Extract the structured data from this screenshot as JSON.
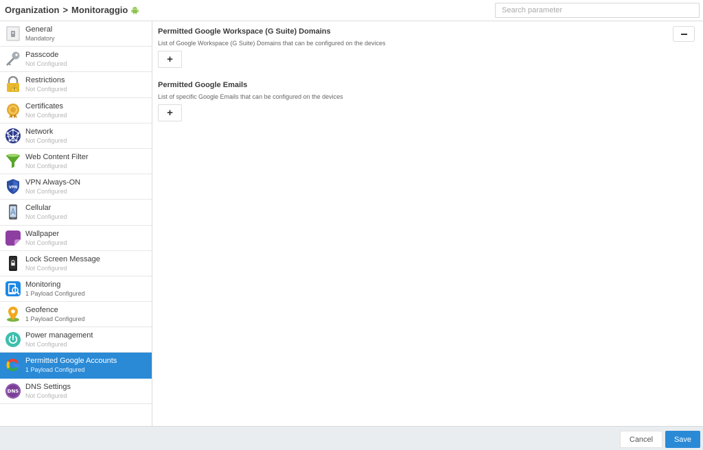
{
  "header": {
    "breadcrumb_root": "Organization",
    "breadcrumb_separator": ">",
    "breadcrumb_current": "Monitoraggio",
    "platform_icon": "android-icon",
    "search_placeholder": "Search parameter"
  },
  "sidebar": {
    "items": [
      {
        "title": "General",
        "status": "Mandatory",
        "icon": "general-icon"
      },
      {
        "title": "Passcode",
        "status": "Not Configured",
        "icon": "key-icon"
      },
      {
        "title": "Restrictions",
        "status": "Not Configured",
        "icon": "restrictions-icon"
      },
      {
        "title": "Certificates",
        "status": "Not Configured",
        "icon": "certificate-icon"
      },
      {
        "title": "Network",
        "status": "Not Configured",
        "icon": "network-icon"
      },
      {
        "title": "Web Content Filter",
        "status": "Not Configured",
        "icon": "funnel-icon"
      },
      {
        "title": "VPN Always-ON",
        "status": "Not Configured",
        "icon": "vpn-shield-icon"
      },
      {
        "title": "Cellular",
        "status": "Not Configured",
        "icon": "cellular-icon"
      },
      {
        "title": "Wallpaper",
        "status": "Not Configured",
        "icon": "wallpaper-icon"
      },
      {
        "title": "Lock Screen Message",
        "status": "Not Configured",
        "icon": "lock-screen-icon"
      },
      {
        "title": "Monitoring",
        "status": "1 Payload Configured",
        "icon": "monitoring-icon"
      },
      {
        "title": "Geofence",
        "status": "1 Payload Configured",
        "icon": "geofence-icon"
      },
      {
        "title": "Power management",
        "status": "Not Configured",
        "icon": "power-icon"
      },
      {
        "title": "Permitted Google Accounts",
        "status": "1 Payload Configured",
        "icon": "google-icon",
        "active": true
      },
      {
        "title": "DNS Settings",
        "status": "Not Configured",
        "icon": "dns-icon"
      }
    ]
  },
  "main": {
    "domains_title": "Permitted Google Workspace (G Suite) Domains",
    "domains_desc": "List of Google Workspace (G Suite) Domains that can be configured on the devices",
    "emails_title": "Permitted Google Emails",
    "emails_desc": "List of specific Google Emails that can be configured on the devices",
    "add_label": "+"
  },
  "footer": {
    "cancel_label": "Cancel",
    "save_label": "Save"
  },
  "colors": {
    "accent": "#2a8ad6",
    "footer_bg": "#eaedf0",
    "android_green": "#8bc34a"
  }
}
